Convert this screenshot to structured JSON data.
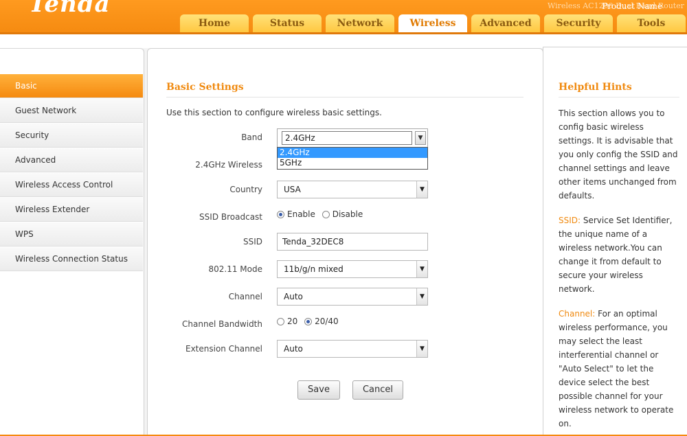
{
  "header": {
    "logo": "Tenda",
    "product_label": "Product Name",
    "product_name": "Wireless AC1200 Dual Band Router"
  },
  "nav": {
    "tabs": [
      "Home",
      "Status",
      "Network",
      "Wireless",
      "Advanced",
      "Security",
      "Tools"
    ],
    "active": "Wireless"
  },
  "sidebar": {
    "items": [
      "Basic",
      "Guest Network",
      "Security",
      "Advanced",
      "Wireless Access Control",
      "Wireless Extender",
      "WPS",
      "Wireless Connection Status"
    ],
    "active": "Basic"
  },
  "main": {
    "title": "Basic Settings",
    "intro": "Use this section to configure wireless basic settings.",
    "band": {
      "label": "Band",
      "value": "2.4GHz",
      "options": [
        "2.4GHz",
        "5GHz"
      ]
    },
    "wireless_24": {
      "label": "2.4GHz Wireless"
    },
    "country": {
      "label": "Country",
      "value": "USA"
    },
    "ssid_broadcast": {
      "label": "SSID Broadcast",
      "enable": "Enable",
      "disable": "Disable",
      "selected": "Enable"
    },
    "ssid": {
      "label": "SSID",
      "value": "Tenda_32DEC8"
    },
    "mode": {
      "label": "802.11 Mode",
      "value": "11b/g/n mixed"
    },
    "channel": {
      "label": "Channel",
      "value": "Auto"
    },
    "bandwidth": {
      "label": "Channel Bandwidth",
      "opt1": "20",
      "opt2": "20/40",
      "selected": "20/40"
    },
    "extension": {
      "label": "Extension Channel",
      "value": "Auto"
    },
    "save": "Save",
    "cancel": "Cancel"
  },
  "hints": {
    "title": "Helpful Hints",
    "p1": "This section allows you to config basic wireless settings. It is advisable that you only config the SSID and channel settings and leave other items unchanged from defaults.",
    "p2_term": "SSID:",
    "p2": " Service Set Identifier, the unique name of a wireless network.You can change it from default to secure your wireless network.",
    "p3_term": "Channel:",
    "p3": " For an optimal wireless performance, you may select the least interferential channel or \"Auto Select\" to let the device select the best possible channel for your wireless network to operate on."
  },
  "colors": {
    "accent": "#f58a10",
    "tab_bg": "#ffc53a",
    "selection": "#3399ff"
  },
  "icons": {
    "dropdown": "chevron-down-icon",
    "radio": "radio-icon"
  }
}
